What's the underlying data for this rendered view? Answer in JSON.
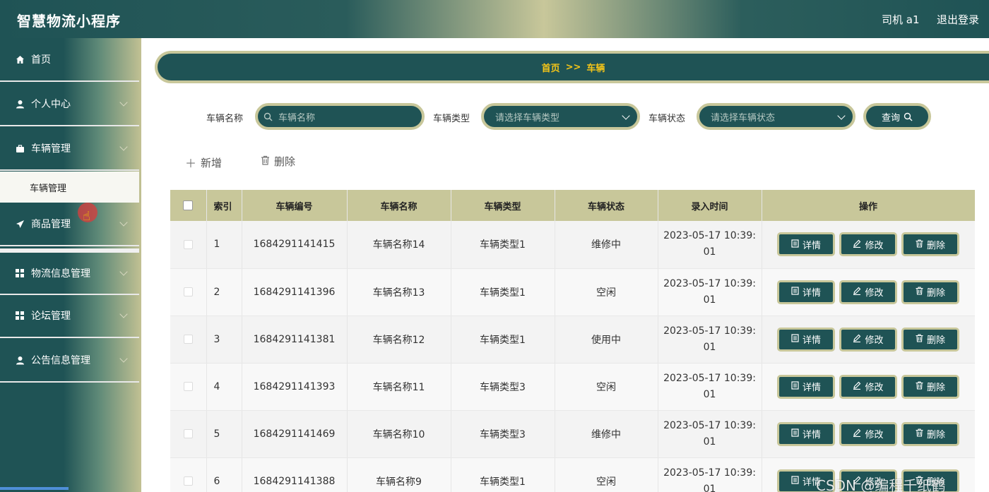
{
  "header": {
    "app_title": "智慧物流小程序",
    "user": "司机 a1",
    "logout": "退出登录"
  },
  "sidebar": {
    "items": [
      {
        "label": "首页",
        "icon": "home-icon",
        "has_arrow": false
      },
      {
        "label": "个人中心",
        "icon": "user-icon",
        "has_arrow": true
      },
      {
        "label": "车辆管理",
        "icon": "briefcase-icon",
        "has_arrow": true
      },
      {
        "label": "商品管理",
        "icon": "send-icon",
        "has_arrow": true
      },
      {
        "label": "物流信息管理",
        "icon": "grid-icon",
        "has_arrow": true
      },
      {
        "label": "论坛管理",
        "icon": "grid-icon",
        "has_arrow": true
      },
      {
        "label": "公告信息管理",
        "icon": "user-icon",
        "has_arrow": true
      }
    ],
    "submenu": {
      "label": "车辆管理"
    }
  },
  "breadcrumb": {
    "home": "首页",
    "sep": ">>",
    "current": "车辆"
  },
  "search": {
    "name_label": "车辆名称",
    "name_placeholder": "车辆名称",
    "type_label": "车辆类型",
    "type_placeholder": "请选择车辆类型",
    "status_label": "车辆状态",
    "status_placeholder": "请选择车辆状态",
    "query_label": "查询"
  },
  "toolbar": {
    "add_label": "新增",
    "delete_label": "删除"
  },
  "table": {
    "headers": [
      "索引",
      "车辆编号",
      "车辆名称",
      "车辆类型",
      "车辆状态",
      "录入时间",
      "操作"
    ],
    "action_labels": {
      "detail": "详情",
      "edit": "修改",
      "delete": "删除"
    },
    "rows": [
      {
        "index": "1",
        "code": "1684291141415",
        "name": "车辆名称14",
        "type": "车辆类型1",
        "status": "维修中",
        "time_1": "2023-05-17 10:39:",
        "time_2": "01"
      },
      {
        "index": "2",
        "code": "1684291141396",
        "name": "车辆名称13",
        "type": "车辆类型1",
        "status": "空闲",
        "time_1": "2023-05-17 10:39:",
        "time_2": "01"
      },
      {
        "index": "3",
        "code": "1684291141381",
        "name": "车辆名称12",
        "type": "车辆类型1",
        "status": "使用中",
        "time_1": "2023-05-17 10:39:",
        "time_2": "01"
      },
      {
        "index": "4",
        "code": "1684291141393",
        "name": "车辆名称11",
        "type": "车辆类型3",
        "status": "空闲",
        "time_1": "2023-05-17 10:39:",
        "time_2": "01"
      },
      {
        "index": "5",
        "code": "1684291141469",
        "name": "车辆名称10",
        "type": "车辆类型3",
        "status": "维修中",
        "time_1": "2023-05-17 10:39:",
        "time_2": "01"
      },
      {
        "index": "6",
        "code": "1684291141388",
        "name": "车辆名称9",
        "type": "车辆类型1",
        "status": "空闲",
        "time_1": "2023-05-17 10:39:",
        "time_2": "01"
      }
    ]
  },
  "watermark": "CSDN @编程千纸鹤",
  "colors": {
    "primary": "#1f5355",
    "accent": "#c8c79a",
    "breadcrumb_text": "#f5c518"
  }
}
